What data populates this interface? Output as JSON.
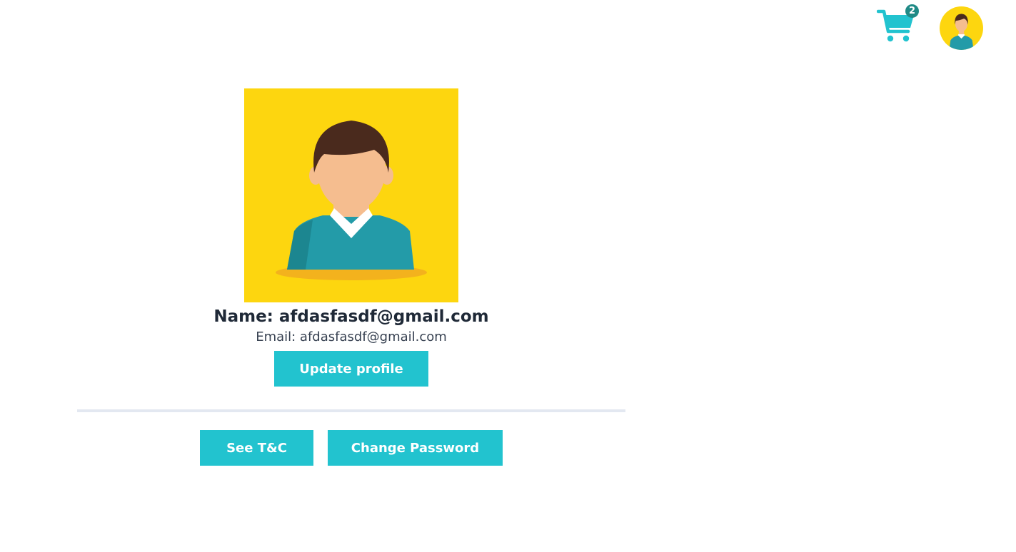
{
  "colors": {
    "accent": "#22c3cf",
    "badge": "#1f8a86",
    "avatar_bg": "#fdd60f",
    "shirt": "#239ba8",
    "hair": "#4a2a1d",
    "skin": "#f5bd8f"
  },
  "header": {
    "cart_icon": "shopping-cart-icon",
    "cart_count": "2",
    "avatar_icon": "user-avatar-icon"
  },
  "profile": {
    "name": "Name: afdasfasdf@gmail.com",
    "email": "Email: afdasfasdf@gmail.com",
    "update_label": "Update profile"
  },
  "actions": {
    "tc_label": "See T&C",
    "password_label": "Change Password"
  }
}
